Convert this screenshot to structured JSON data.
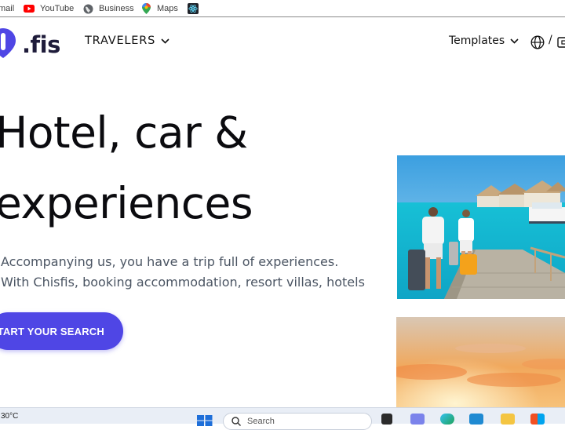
{
  "bookmarks": [
    {
      "label": "mail",
      "icon": "gmail-icon"
    },
    {
      "label": "YouTube",
      "icon": "youtube-icon"
    },
    {
      "label": "Business",
      "icon": "globe-icon"
    },
    {
      "label": "Maps",
      "icon": "maps-pin-icon"
    },
    {
      "label": "",
      "icon": "react-icon"
    }
  ],
  "header": {
    "logo_text": ".fis",
    "nav_travelers": "TRAVELERS",
    "nav_templates": "Templates",
    "slash": "/"
  },
  "hero": {
    "title_line1": "Hotel, car &",
    "title_line2": "experiences",
    "description": "Accompanying us, you have a trip full of experiences. With Chisfis, booking accommodation, resort villas, hotels",
    "cta_label": "START YOUR SEARCH"
  },
  "taskbar": {
    "temperature": "30°C",
    "search_placeholder": "Search"
  },
  "colors": {
    "accent": "#4f46e5",
    "text_dark": "#0b0b0f",
    "text_muted": "#4b5563"
  }
}
